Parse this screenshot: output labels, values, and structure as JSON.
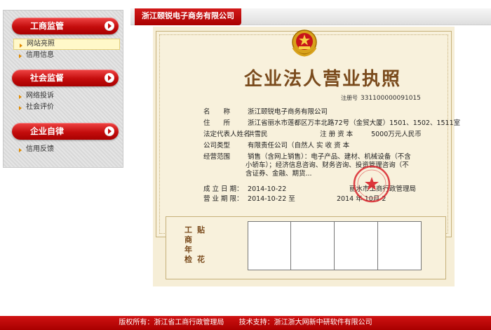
{
  "sidebar": {
    "groups": [
      {
        "title": "工商监管",
        "items": [
          "网站亮照",
          "信用信息"
        ]
      },
      {
        "title": "社会监督",
        "items": [
          "网络投诉",
          "社会评价"
        ]
      },
      {
        "title": "企业自律",
        "items": [
          "信用反馈"
        ]
      }
    ]
  },
  "header": {
    "company_tab": "浙江颐锐电子商务有限公司"
  },
  "certificate": {
    "title": "企业法人营业执照",
    "reg_label": "注册号",
    "reg_no": "331100000091015",
    "name_label": "名　　称",
    "name": "浙江颐锐电子商务有限公司",
    "address_label": "住　　所",
    "address": "浙江省丽水市莲都区万丰北路72号（金贸大厦）1501、1502、1511室",
    "legal_label": "法定代表人姓名",
    "legal": "洪雪民",
    "capital_label": "注 册 资 本",
    "capital": "5000万元人民币",
    "type_label": "公司类型",
    "type": "有限责任公司（自然人  实 收 资 本",
    "scope_label": "经营范围",
    "scope_lines": [
      "销售（含网上销售）：电子产品、建材、机械设备（不含",
      "小轿车）；经济信息咨询、财务咨询、投资管理咨询（不",
      "含证券、金融、期货..."
    ],
    "est_label": "成 立 日 期：",
    "est_date": "2014-10-22",
    "term_label": "营 业 期 限：",
    "term": "2014-10-22 至",
    "authority": "丽水市工商行政管理局",
    "issue_date": "2014 年 10月 2",
    "inspect_left": [
      "工",
      "商",
      "年",
      "检"
    ],
    "inspect_right": [
      "贴",
      "",
      "",
      "花"
    ]
  },
  "footer": {
    "copyright": "版权所有：浙江省工商行政管理局",
    "tech": "技术支持：浙江浙大网新中研软件有限公司"
  },
  "colors": {
    "accent_red": "#c40d0d",
    "cert_brown": "#7a4b1d",
    "cert_bg": "#f8f1dc"
  }
}
